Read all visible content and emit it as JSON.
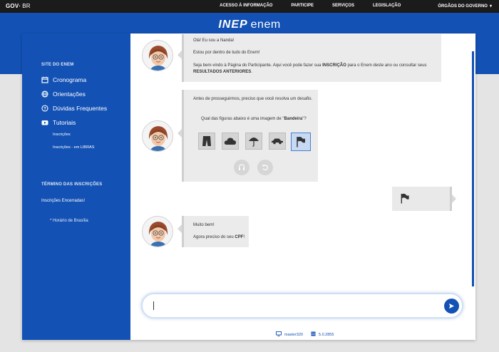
{
  "gov": {
    "logo_gov": "GOV",
    "logo_br": "BR",
    "links": [
      "ACESSO À INFORMAÇÃO",
      "PARTICIPE",
      "SERVIÇOS",
      "LEGISLAÇÃO",
      "ÓRGÃOS DO GOVERNO"
    ]
  },
  "brand": {
    "inep": "INEP",
    "enem": "enem"
  },
  "sidebar": {
    "section1": "SITE DO ENEM",
    "items": [
      {
        "label": "Cronograma",
        "icon": "calendar-icon"
      },
      {
        "label": "Orientações",
        "icon": "globe-icon"
      },
      {
        "label": "Dúvidas Frequentes",
        "icon": "help-circle-icon"
      },
      {
        "label": "Tutoriais",
        "icon": "play-icon"
      }
    ],
    "subitems": [
      "Inscrições",
      "Inscrições - em LIBRAS"
    ],
    "section2": "TÉRMINO DAS INSCRIÇÕES",
    "status": "Inscrições Encerradas!",
    "note": "* Horário de Brasília"
  },
  "chat": {
    "msg1": {
      "line1": "Olá! Eu sou a Nanda!",
      "line2": "Estou por dentro de tudo do Enem!",
      "line3a": "Seja bem-vindo à Página do Participante. Aqui você pode fazer sua ",
      "line3b": "INSCRIÇÃO",
      "line3c": " para o Enem deste ano ou consultar seus",
      "line4": "RESULTADOS ANTERIORES",
      "line4end": "."
    },
    "msg2": {
      "intro": "Antes de prosseguirmos, preciso que você resolva um desafio.",
      "question_a": "Qual das figuras abaixo é uma imagem de \"",
      "question_b": "Bandeira",
      "question_c": "\"?",
      "figures": [
        "pants-icon",
        "cloud-icon",
        "umbrella-icon",
        "car-icon",
        "flag-icon"
      ],
      "selected_figure": "flag-icon"
    },
    "user_reply_icon": "flag-icon",
    "msg3": {
      "line1": "Muito bem!",
      "line2a": "Agora preciso do seu ",
      "line2b": "CPF",
      "line2c": "!"
    }
  },
  "input": {
    "value": "",
    "placeholder": ""
  },
  "footer": {
    "server": "master320",
    "version": "5.0.2855"
  },
  "colors": {
    "brand_blue": "#1351b4",
    "govbar": "#1b1b1b",
    "bubble": "#ebebeb"
  }
}
